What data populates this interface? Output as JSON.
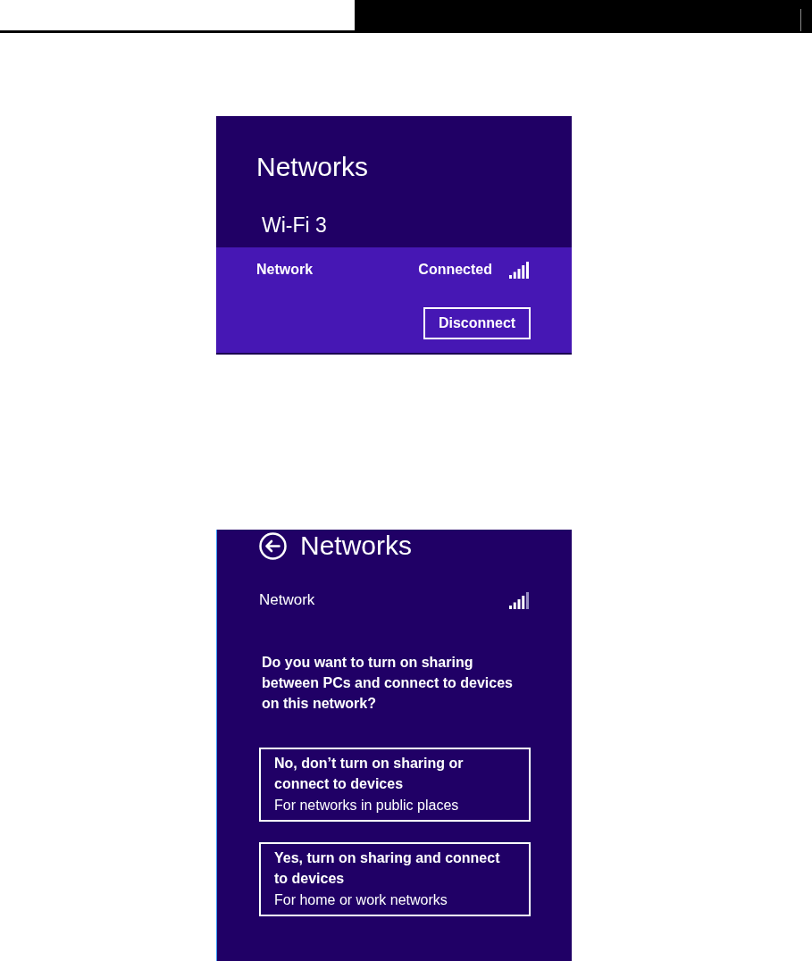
{
  "network_flyout": {
    "title": "Networks",
    "adapter": "Wi-Fi 3",
    "networks": [
      {
        "name": "Network",
        "status": "Connected",
        "selected": true,
        "action": "Disconnect"
      }
    ]
  },
  "sharing_prompt": {
    "title": "Networks",
    "network": "Network",
    "question": "Do you want to turn on sharing between PCs and connect to devices on this network?",
    "options": [
      {
        "title": "No, don’t turn on sharing or connect to devices",
        "description": "For networks in public places"
      },
      {
        "title": "Yes, turn on sharing and connect to devices",
        "description": "For home or work networks"
      }
    ]
  }
}
